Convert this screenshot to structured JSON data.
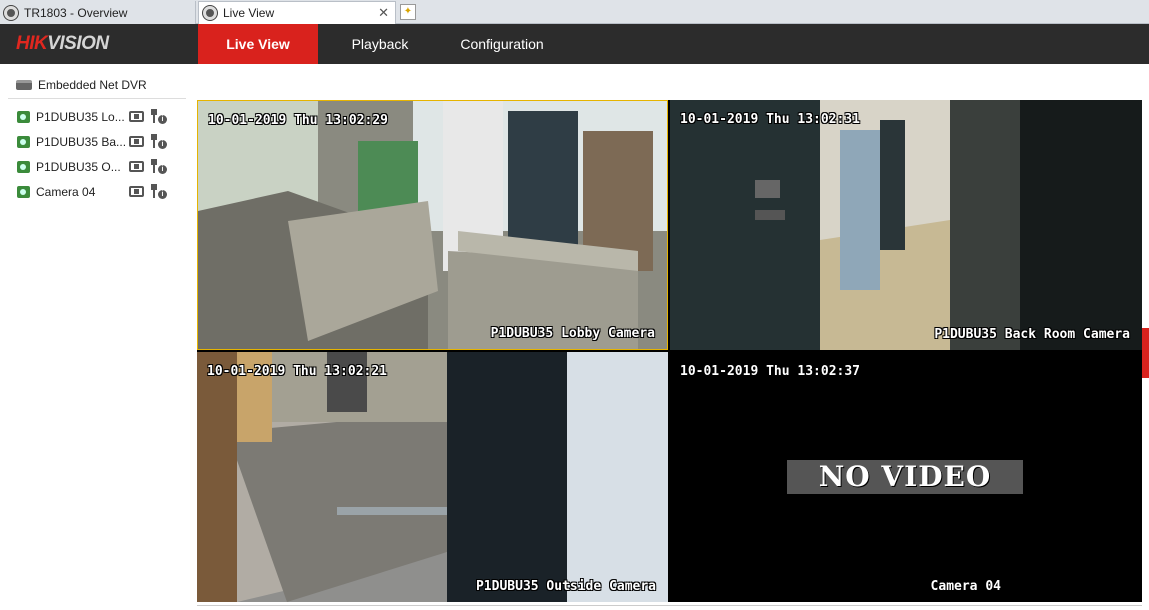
{
  "browser": {
    "tabs": [
      {
        "label": "TR1803 - Overview"
      },
      {
        "label": "Live View",
        "close": "✕"
      }
    ]
  },
  "header": {
    "logo_main": "HIK",
    "logo_accent": "VISION",
    "nav": [
      {
        "label": "Live View",
        "active": true
      },
      {
        "label": "Playback"
      },
      {
        "label": "Configuration"
      }
    ],
    "accent_color": "#d9221d"
  },
  "tree": {
    "root_label": "Embedded Net DVR",
    "cameras": [
      {
        "label": "P1DUBU35 Lo..."
      },
      {
        "label": "P1DUBU35 Ba..."
      },
      {
        "label": "P1DUBU35 O..."
      },
      {
        "label": "Camera 04"
      }
    ]
  },
  "tiles": [
    {
      "timestamp": "10-01-2019 Thu 13:02:29",
      "name": "P1DUBU35 Lobby Camera",
      "selected": true
    },
    {
      "timestamp": "10-01-2019 Thu 13:02:31",
      "name": "P1DUBU35 Back Room Camera"
    },
    {
      "timestamp": "10-01-2019 Thu 13:02:21",
      "name": "P1DUBU35 Outside Camera"
    },
    {
      "timestamp": "10-01-2019 Thu 13:02:37",
      "name": "Camera 04",
      "overlay": "NO VIDEO"
    }
  ]
}
